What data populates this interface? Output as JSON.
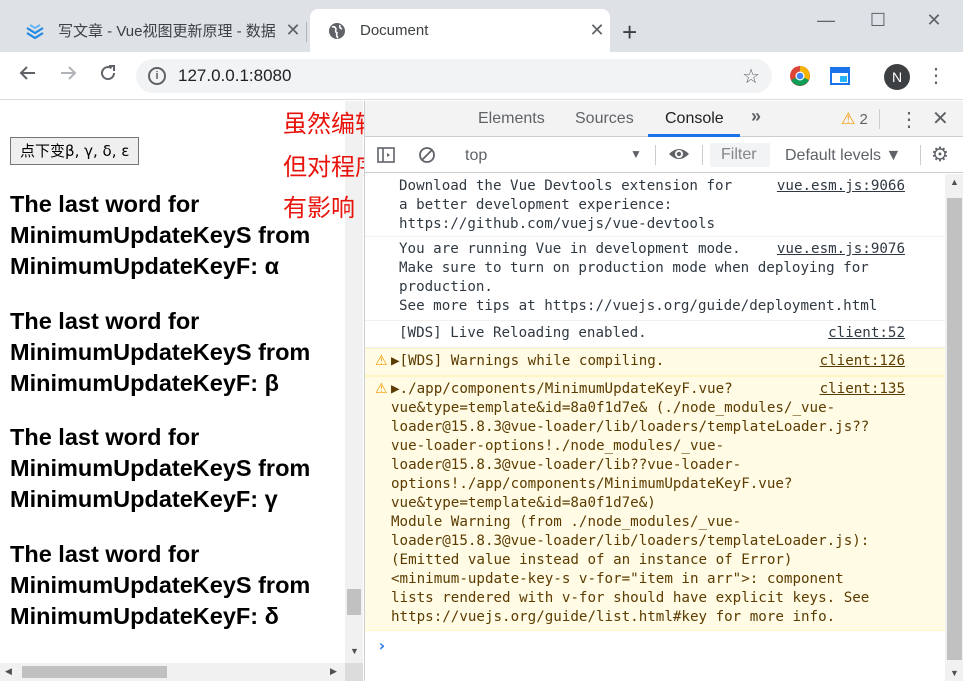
{
  "tabs": [
    {
      "title": "写文章 - Vue视图更新原理 - 数据",
      "close": "✕",
      "icon": "csdn-favicon"
    },
    {
      "title": "Document",
      "close": "✕",
      "icon": "globe-icon"
    }
  ],
  "new_tab": "+",
  "window_controls": {
    "minimize": "—",
    "maximize": "☐",
    "close": "✕"
  },
  "address": {
    "url": "127.0.0.1:8080",
    "info": "i"
  },
  "profile": {
    "initial": "N"
  },
  "page": {
    "button_label": "点下变β, γ, δ, ε",
    "blocks": [
      "The last word for MinimumUpdateKeyS from MinimumUpdateKeyF: α",
      "The last word for MinimumUpdateKeyS from MinimumUpdateKeyF: β",
      "The last word for MinimumUpdateKeyS from MinimumUpdateKeyF: γ",
      "The last word for MinimumUpdateKeyS from MinimumUpdateKeyF: δ"
    ]
  },
  "annotation": {
    "line1": "虽然编辑器报错",
    "line2": "但对程序实际没",
    "line3": "有影响",
    "color": "#e8140c"
  },
  "devtools": {
    "tabs": [
      "Elements",
      "Sources",
      "Console"
    ],
    "active_tab": "Console",
    "more": "»",
    "warning_count": "2",
    "context": "top",
    "filter_placeholder": "Filter",
    "levels": "Default levels ▼",
    "messages": [
      {
        "type": "info",
        "text": "Download the Vue Devtools extension for\na better development experience:\nhttps://github.com/vuejs/vue-devtools",
        "source": "vue.esm.js:9066"
      },
      {
        "type": "info",
        "text": "You are running Vue in development mode.\nMake sure to turn on production mode when deploying for\nproduction.\nSee more tips at https://vuejs.org/guide/deployment.html",
        "source": "vue.esm.js:9076"
      },
      {
        "type": "info",
        "text": "[WDS] Live Reloading enabled.",
        "source": "client:52"
      },
      {
        "type": "warning",
        "text": "▶[WDS] Warnings while compiling.",
        "source": "client:126"
      },
      {
        "type": "warning",
        "text": "▶./app/components/MinimumUpdateKeyF.vue?\nvue&type=template&id=8a0f1d7e& (./node_modules/_vue-\nloader@15.8.3@vue-loader/lib/loaders/templateLoader.js??\nvue-loader-options!./node_modules/_vue-\nloader@15.8.3@vue-loader/lib??vue-loader-\noptions!./app/components/MinimumUpdateKeyF.vue?\nvue&type=template&id=8a0f1d7e&)\nModule Warning (from ./node_modules/_vue-\nloader@15.8.3@vue-loader/lib/loaders/templateLoader.js):\n(Emitted value instead of an instance of Error)\n<minimum-update-key-s v-for=\"item in arr\">: component\nlists rendered with v-for should have explicit keys. See\nhttps://vuejs.org/guide/list.html#key for more info.",
        "source": "client:135"
      }
    ],
    "prompt": "›"
  }
}
